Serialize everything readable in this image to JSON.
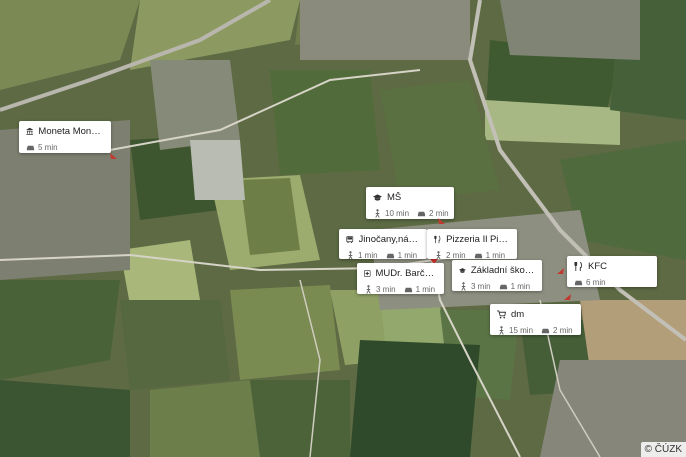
{
  "map": {
    "credit": "© ČÚZK"
  },
  "pois": [
    {
      "name": "Moneta Money B...",
      "icon": "bank-icon",
      "walk": "",
      "drive": "5 min"
    },
    {
      "name": "MŠ",
      "icon": "school-icon",
      "walk": "10 min",
      "drive": "2 min"
    },
    {
      "name": "Jinočany,náměstí",
      "icon": "bus-icon",
      "walk": "1 min",
      "drive": "1 min"
    },
    {
      "name": "Pizzeria Il Pinocc...",
      "icon": "restaurant-icon",
      "walk": "2 min",
      "drive": "1 min"
    },
    {
      "name": "MUDr. Barčáková ...",
      "icon": "medical-icon",
      "walk": "3 min",
      "drive": "1 min"
    },
    {
      "name": "Základní škola Jin...",
      "icon": "school-icon",
      "walk": "3 min",
      "drive": "1 min"
    },
    {
      "name": "KFC",
      "icon": "restaurant-icon",
      "walk": "",
      "drive": "6 min"
    },
    {
      "name": "dm",
      "icon": "shopping-cart-icon",
      "walk": "15 min",
      "drive": "2 min"
    }
  ]
}
